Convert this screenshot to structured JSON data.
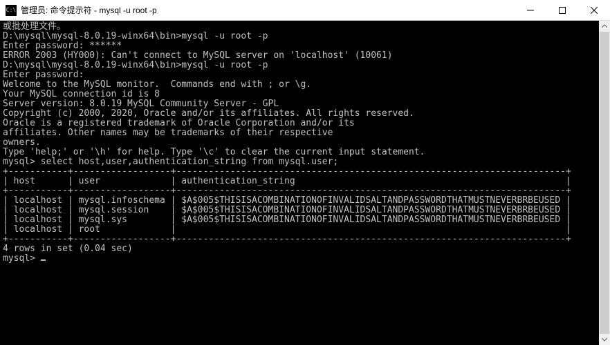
{
  "window": {
    "title": "管理员: 命令提示符 - mysql  -u root -p",
    "icon_label": "C:\\"
  },
  "terminal": {
    "lines": [
      "或批处理文件。",
      "",
      "D:\\mysql\\mysql-8.0.19-winx64\\bin>mysql -u root -p",
      "Enter password: ******",
      "ERROR 2003 (HY000): Can't connect to MySQL server on 'localhost' (10061)",
      "",
      "D:\\mysql\\mysql-8.0.19-winx64\\bin>mysql -u root -p",
      "Enter password:",
      "Welcome to the MySQL monitor.  Commands end with ; or \\g.",
      "Your MySQL connection id is 8",
      "Server version: 8.0.19 MySQL Community Server - GPL",
      "",
      "Copyright (c) 2000, 2020, Oracle and/or its affiliates. All rights reserved.",
      "",
      "Oracle is a registered trademark of Oracle Corporation and/or its",
      "affiliates. Other names may be trademarks of their respective",
      "owners.",
      "",
      "Type 'help;' or '\\h' for help. Type '\\c' to clear the current input statement.",
      "",
      "mysql> select host,user,authentication_string from mysql.user;",
      "+-----------+------------------+------------------------------------------------------------------------+",
      "| host      | user             | authentication_string                                                  |",
      "+-----------+------------------+------------------------------------------------------------------------+",
      "| localhost | mysql.infoschema | $A$005$THISISACOMBINATIONOFINVALIDSALTANDPASSWORDTHATMUSTNEVERBRBEUSED |",
      "| localhost | mysql.session    | $A$005$THISISACOMBINATIONOFINVALIDSALTANDPASSWORDTHATMUSTNEVERBRBEUSED |",
      "| localhost | mysql.sys        | $A$005$THISISACOMBINATIONOFINVALIDSALTANDPASSWORDTHATMUSTNEVERBRBEUSED |",
      "| localhost | root             |                                                                        |",
      "+-----------+------------------+------------------------------------------------------------------------+",
      "4 rows in set (0.04 sec)",
      "",
      "mysql> "
    ],
    "cursor_line_index": 31,
    "query_result": {
      "columns": [
        "host",
        "user",
        "authentication_string"
      ],
      "rows": [
        [
          "localhost",
          "mysql.infoschema",
          "$A$005$THISISACOMBINATIONOFINVALIDSALTANDPASSWORDTHATMUSTNEVERBRBEUSED"
        ],
        [
          "localhost",
          "mysql.session",
          "$A$005$THISISACOMBINATIONOFINVALIDSALTANDPASSWORDTHATMUSTNEVERBRBEUSED"
        ],
        [
          "localhost",
          "mysql.sys",
          "$A$005$THISISACOMBINATIONOFINVALIDSALTANDPASSWORDTHATMUSTNEVERBRBEUSED"
        ],
        [
          "localhost",
          "root",
          ""
        ]
      ],
      "row_count": 4,
      "elapsed_sec": 0.04
    }
  }
}
